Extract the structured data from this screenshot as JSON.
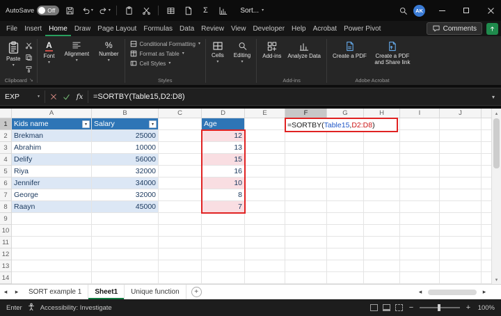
{
  "titlebar": {
    "autosave_label": "AutoSave",
    "autosave_state": "Off",
    "workbook_title": "Sort...",
    "avatar_initials": "AK"
  },
  "ribbon_tabs": {
    "items": [
      "File",
      "Insert",
      "Home",
      "Draw",
      "Page Layout",
      "Formulas",
      "Data",
      "Review",
      "View",
      "Developer",
      "Help",
      "Acrobat",
      "Power Pivot"
    ],
    "active": "Home",
    "comments_label": "Comments"
  },
  "ribbon": {
    "paste_label": "Paste",
    "font_label": "Font",
    "alignment_label": "Alignment",
    "number_label": "Number",
    "conditional_formatting_label": "Conditional Formatting",
    "format_as_table_label": "Format as Table",
    "cell_styles_label": "Cell Styles",
    "cells_label": "Cells",
    "editing_label": "Editing",
    "addins_label": "Add-ins",
    "analyze_data_label": "Analyze Data",
    "create_pdf_label": "Create a PDF",
    "create_pdf_share_label": "Create a PDF and Share link",
    "group_clipboard_label": "Clipboard",
    "group_styles_label": "Styles",
    "group_addins_label": "Add-ins",
    "group_acrobat_label": "Adobe Acrobat"
  },
  "formula_bar": {
    "name_box_value": "EXP",
    "formula": "=SORTBY(Table15,D2:D8)"
  },
  "formula_cell": {
    "segments": [
      {
        "text": "=SORTBY(",
        "color": "#1a1a1a"
      },
      {
        "text": "Table15",
        "color": "#2057c7"
      },
      {
        "text": ",",
        "color": "#1a1a1a"
      },
      {
        "text": "D2:D8",
        "color": "#cc1414"
      },
      {
        "text": ")",
        "color": "#1a1a1a"
      }
    ]
  },
  "grid": {
    "col_headers": [
      "A",
      "B",
      "C",
      "D",
      "E",
      "F",
      "G",
      "H",
      "I",
      "J"
    ],
    "row_count": 14,
    "active_col": "F",
    "active_row": 1,
    "table": {
      "name_header": "Kids name",
      "salary_header": "Salary",
      "age_header": "Age",
      "rows": [
        {
          "name": "Brekman",
          "salary": "25000",
          "age": "12"
        },
        {
          "name": "Abrahim",
          "salary": "10000",
          "age": "13"
        },
        {
          "name": "Delify",
          "salary": "56000",
          "age": "15"
        },
        {
          "name": "Riya",
          "salary": "32000",
          "age": "16"
        },
        {
          "name": "Jennifer",
          "salary": "34000",
          "age": "10"
        },
        {
          "name": "George",
          "salary": "32000",
          "age": "8"
        },
        {
          "name": "Raayn",
          "salary": "45000",
          "age": "7"
        }
      ]
    },
    "colors": {
      "table_header_bg": "#2e75b6",
      "band_blue": "#dce7f5",
      "band_pink": "#f9dee2",
      "range_border_red": "#e02222",
      "accent_green": "#107C41"
    }
  },
  "sheet_tabs": {
    "items": [
      "SORT example 1",
      "Sheet1",
      "Unique function"
    ],
    "active": "Sheet1"
  },
  "status_bar": {
    "mode": "Enter",
    "accessibility_label": "Accessibility: Investigate",
    "zoom_level": "100%"
  }
}
